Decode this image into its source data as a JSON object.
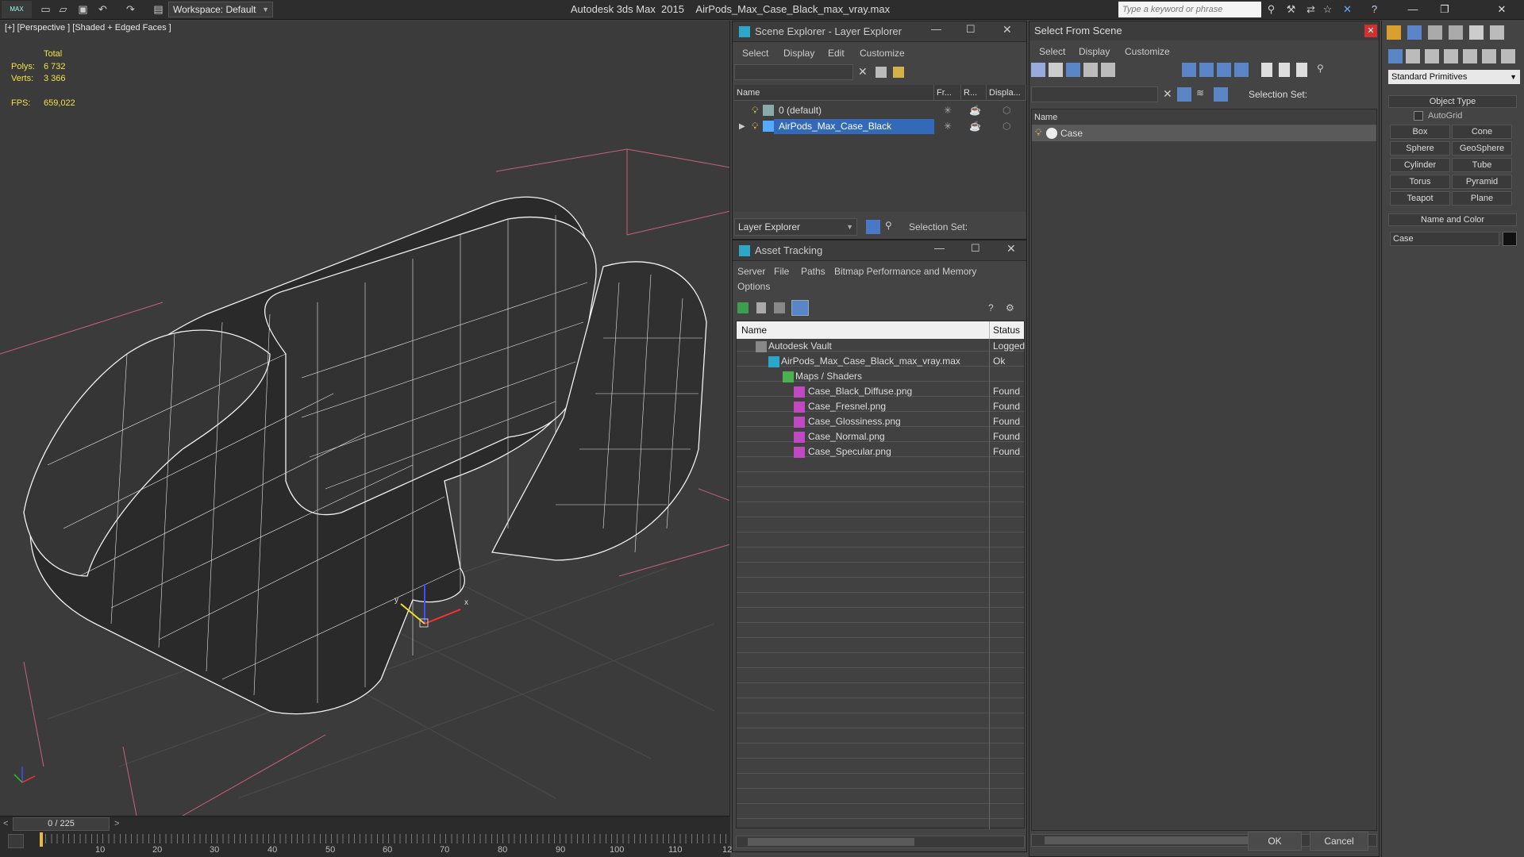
{
  "titlebar": {
    "logo": "MAX",
    "workspace": "Workspace: Default",
    "app": "Autodesk 3ds Max  2015",
    "file": "AirPods_Max_Case_Black_max_vray.max",
    "search_placeholder": "Type a keyword or phrase",
    "icons": [
      "new-icon",
      "open-icon",
      "save-icon",
      "undo-icon",
      "redo-icon",
      "workspace-icon",
      "binoculars-icon",
      "wrench-icon",
      "connect-icon",
      "star-icon",
      "exchange-icon",
      "help-icon"
    ]
  },
  "viewport": {
    "label": "[+] [Perspective ] [Shaded + Edged Faces ]",
    "total_label": "Total",
    "polys_label": "Polys:",
    "polys_value": "6 732",
    "verts_label": "Verts:",
    "verts_value": "3 366",
    "fps_label": "FPS:",
    "fps_value": "659,022"
  },
  "timeline": {
    "frame": "0 / 225",
    "ticks": [
      "10",
      "20",
      "30",
      "40",
      "50",
      "60",
      "70",
      "80",
      "90",
      "100",
      "110",
      "12"
    ]
  },
  "scene_explorer": {
    "title": "Scene Explorer - Layer Explorer",
    "menu": [
      "Select",
      "Display",
      "Edit",
      "Customize"
    ],
    "columns": [
      "Name",
      "Fr...",
      "R...",
      "Displa..."
    ],
    "rows": [
      {
        "name": "0 (default)",
        "selected": false
      },
      {
        "name": "AirPods_Max_Case_Black",
        "selected": true
      }
    ],
    "footer_dropdown": "Layer Explorer",
    "footer_selset": "Selection Set:"
  },
  "asset_tracking": {
    "title": "Asset Tracking",
    "menu": [
      "Server",
      "File",
      "Paths",
      "Bitmap Performance and Memory"
    ],
    "menu2": "Options",
    "columns": [
      "Name",
      "Status"
    ],
    "rows": [
      {
        "name": "Autodesk Vault",
        "status": "Logged",
        "indent": 0
      },
      {
        "name": "AirPods_Max_Case_Black_max_vray.max",
        "status": "Ok",
        "indent": 1
      },
      {
        "name": "Maps / Shaders",
        "status": "",
        "indent": 2
      },
      {
        "name": "Case_Black_Diffuse.png",
        "status": "Found",
        "indent": 3
      },
      {
        "name": "Case_Fresnel.png",
        "status": "Found",
        "indent": 3
      },
      {
        "name": "Case_Glossiness.png",
        "status": "Found",
        "indent": 3
      },
      {
        "name": "Case_Normal.png",
        "status": "Found",
        "indent": 3
      },
      {
        "name": "Case_Specular.png",
        "status": "Found",
        "indent": 3
      }
    ]
  },
  "select_from_scene": {
    "title": "Select From Scene",
    "menu": [
      "Select",
      "Display",
      "Customize"
    ],
    "selset": "Selection Set:",
    "column": "Name",
    "rows": [
      "Case"
    ],
    "ok": "OK",
    "cancel": "Cancel"
  },
  "command_panel": {
    "dropdown": "Standard Primitives",
    "object_type": "Object Type",
    "autogrid": "AutoGrid",
    "buttons": [
      "Box",
      "Cone",
      "Sphere",
      "GeoSphere",
      "Cylinder",
      "Tube",
      "Torus",
      "Pyramid",
      "Teapot",
      "Plane"
    ],
    "name_and_color": "Name and Color",
    "name_value": "Case",
    "color": "#111111"
  }
}
